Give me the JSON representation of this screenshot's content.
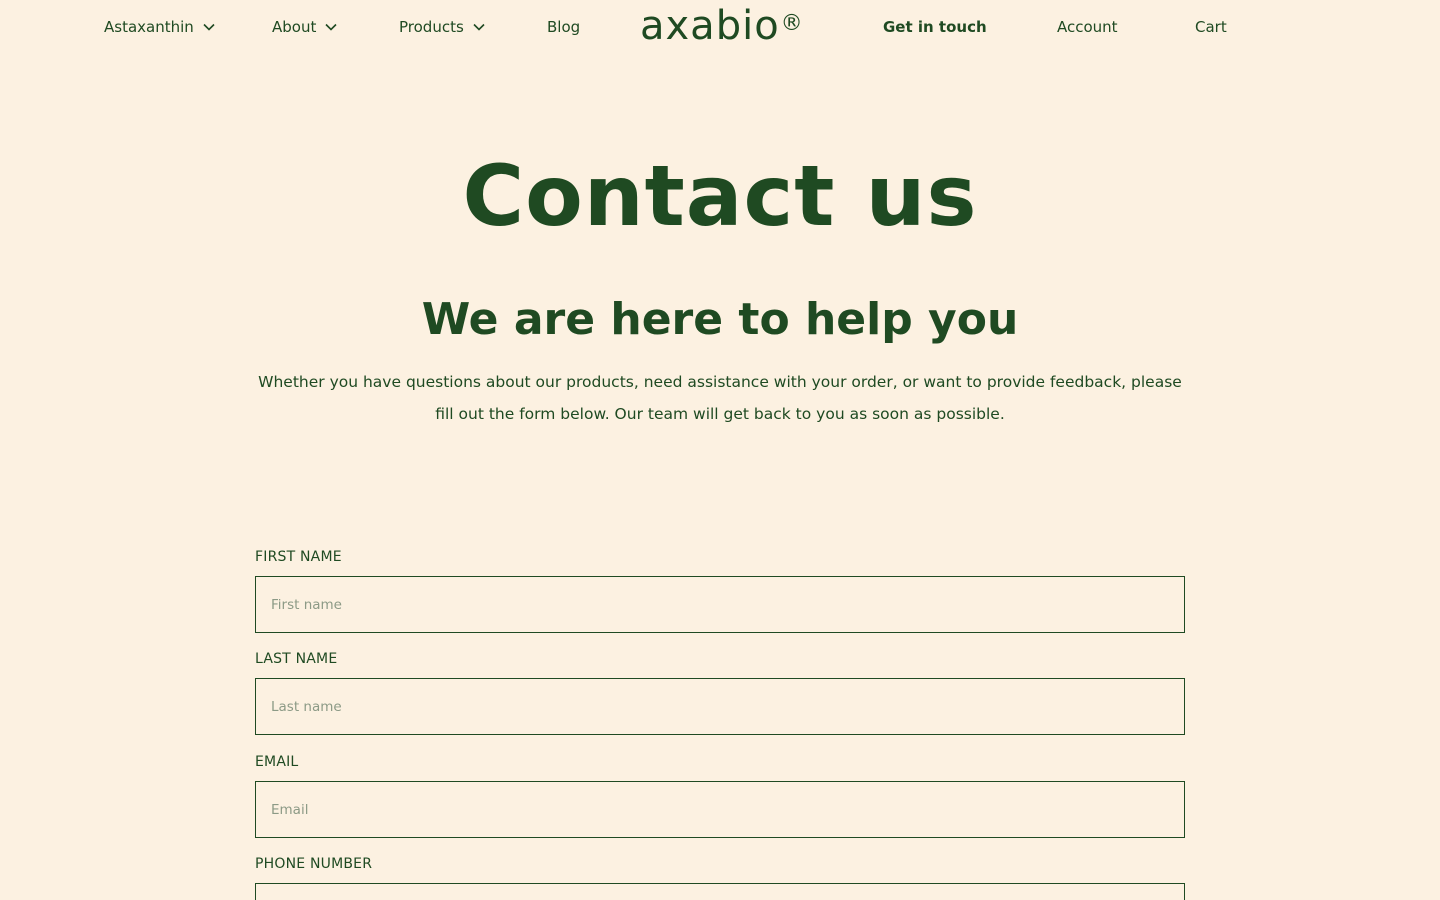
{
  "nav": {
    "left_items": [
      {
        "label": "Astaxanthin",
        "has_dropdown": true
      },
      {
        "label": "About",
        "has_dropdown": true
      },
      {
        "label": "Products",
        "has_dropdown": true
      },
      {
        "label": "Blog",
        "has_dropdown": false
      }
    ],
    "logo": {
      "text": "axabio",
      "mark": "®"
    },
    "right_items": [
      {
        "label": "Get in touch"
      },
      {
        "label": "Account"
      },
      {
        "label": "Cart"
      }
    ]
  },
  "hero": {
    "title": "Contact us",
    "subtitle": "We are here to help you",
    "body": "Whether you have questions about our products, need assistance with your order, or want to provide feedback, please fill out the form below. Our team will get back to you as soon as possible."
  },
  "form": {
    "fields": [
      {
        "label": "FIRST NAME",
        "placeholder": "First name",
        "value": ""
      },
      {
        "label": "LAST NAME",
        "placeholder": "Last name",
        "value": ""
      },
      {
        "label": "EMAIL",
        "placeholder": "Email",
        "value": ""
      },
      {
        "label": "PHONE NUMBER",
        "placeholder": "",
        "value": ""
      }
    ]
  },
  "colors": {
    "background": "#FCF1E1",
    "brand_green": "#1F4A22",
    "placeholder": "#8C9A86"
  },
  "icons": {
    "dropdown": "chevron-down-icon"
  }
}
